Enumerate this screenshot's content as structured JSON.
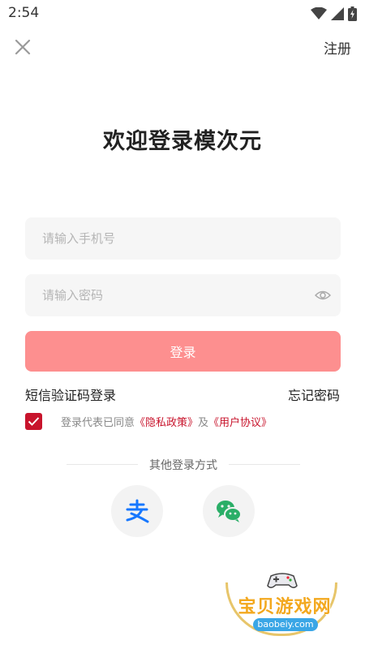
{
  "status_bar": {
    "time": "2:54",
    "icons": [
      "wifi-icon",
      "signal-icon",
      "battery-icon"
    ]
  },
  "header": {
    "close_icon": "close-icon",
    "register_label": "注册"
  },
  "welcome": {
    "title": "欢迎登录模次元"
  },
  "form": {
    "phone_placeholder": "请输入手机号",
    "phone_value": "",
    "password_placeholder": "请输入密码",
    "password_value": "",
    "password_toggle_icon": "eye-icon",
    "login_label": "登录"
  },
  "links": {
    "sms_login": "短信验证码登录",
    "forgot_password": "忘记密码"
  },
  "agreement": {
    "checked": true,
    "prefix": "登录代表已同意",
    "privacy_link": "《隐私政策》",
    "and": "及",
    "user_link": "《用户协议》"
  },
  "other_login": {
    "label": "其他登录方式",
    "options": [
      {
        "name": "alipay",
        "icon": "alipay-icon"
      },
      {
        "name": "wechat",
        "icon": "wechat-icon"
      }
    ]
  },
  "watermark": {
    "title": "宝贝游戏网",
    "url": "baobeiy.com"
  },
  "colors": {
    "accent": "#c8142c",
    "login_button": "#fd8f8f",
    "field_bg": "#f6f6f6",
    "alipay_blue": "#1677ff",
    "wechat_green": "#2aae67"
  }
}
